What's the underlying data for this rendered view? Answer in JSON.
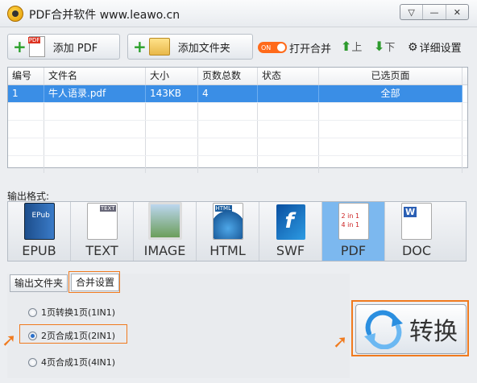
{
  "window": {
    "title": "PDF合并软件 www.leawo.cn"
  },
  "window_controls": {
    "help": "▽",
    "minimize": "—",
    "close": "✕"
  },
  "toolbar": {
    "add_pdf": "添加 PDF",
    "add_folder": "添加文件夹",
    "toggle_text": "ON",
    "open_merge": "打开合并",
    "up": "上",
    "down": "下",
    "settings": "详细设置"
  },
  "table": {
    "headers": [
      "编号",
      "文件名",
      "大小",
      "页数总数",
      "状态",
      "已选页面"
    ],
    "rows": [
      [
        "1",
        "牛人语录.pdf",
        "143KB",
        "4",
        "",
        "全部"
      ]
    ]
  },
  "output": {
    "label": "输出格式:",
    "formats": [
      {
        "label": "EPUB",
        "icon": "epub-book-icon"
      },
      {
        "label": "TEXT",
        "icon": "text-document-icon"
      },
      {
        "label": "IMAGE",
        "icon": "image-icon"
      },
      {
        "label": "HTML",
        "icon": "html-globe-icon"
      },
      {
        "label": "SWF",
        "icon": "flash-icon"
      },
      {
        "label": "PDF",
        "icon": "pdf-2in1-icon"
      },
      {
        "label": "DOC",
        "icon": "word-document-icon"
      }
    ],
    "selected": "PDF"
  },
  "tabs": {
    "output_folder": "输出文件夹",
    "merge_settings": "合并设置",
    "active": "合并设置"
  },
  "merge_options": [
    {
      "label": "1页转换1页(1IN1)",
      "checked": false
    },
    {
      "label": "2页合成1页(2IN1)",
      "checked": true
    },
    {
      "label": "4页合成1页(4IN1)",
      "checked": false
    }
  ],
  "convert": {
    "label": "转换"
  },
  "colors": {
    "accent": "#3a8ee6",
    "highlight": "#f07a1e",
    "format_selected": "#7cb8ef"
  }
}
